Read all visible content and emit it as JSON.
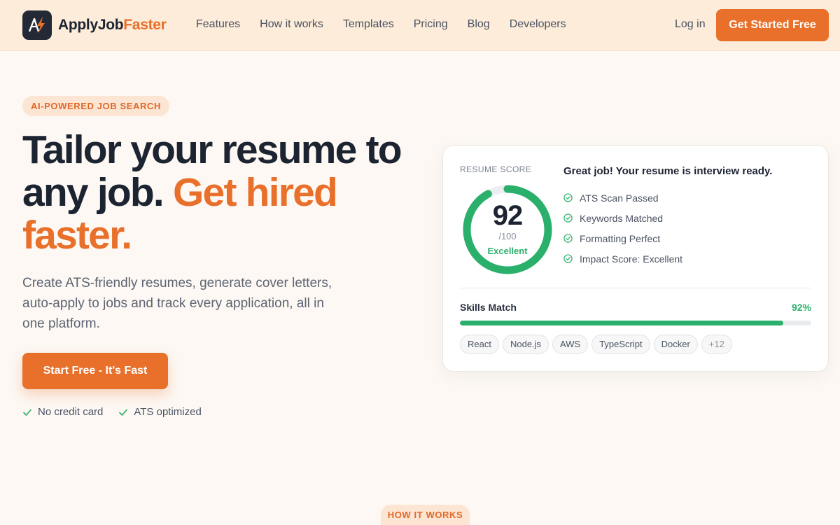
{
  "brand": {
    "name_part1": "ApplyJob",
    "name_part2": "Faster",
    "accent_color": "#e8702a",
    "logo_icon": "lightning-bolt-icon"
  },
  "nav": {
    "links": [
      "Features",
      "How it works",
      "Templates",
      "Pricing",
      "Blog",
      "Developers"
    ],
    "login_label": "Log in",
    "cta_label": "Get Started Free"
  },
  "hero": {
    "badge": "AI-POWERED JOB SEARCH",
    "headline_line1": "Tailor your resume to",
    "headline_line2_prefix": "any job.",
    "headline_highlight": "Get hired faster.",
    "subtext": "Create ATS-friendly resumes, generate cover letters, auto-apply to jobs and track every application, all in one platform.",
    "cta_label": "Start Free - It's Fast",
    "perks": [
      "No credit card",
      "ATS optimized"
    ]
  },
  "score_card": {
    "label": "RESUME SCORE",
    "score": "92",
    "score_value": 92,
    "max": "/100",
    "rating": "Excellent",
    "heading": "Great job! Your resume is interview ready.",
    "checks": [
      "ATS Scan Passed",
      "Keywords Matched",
      "Formatting Perfect",
      "Impact Score: Excellent"
    ],
    "skills_label": "Skills Match",
    "skills_pct_label": "92%",
    "skills_pct": 92,
    "tags": [
      "React",
      "Node.js",
      "AWS",
      "TypeScript",
      "Docker"
    ],
    "more_tag": "+12",
    "success_color": "#2bb06b"
  },
  "section_badge": "HOW IT WORKS"
}
